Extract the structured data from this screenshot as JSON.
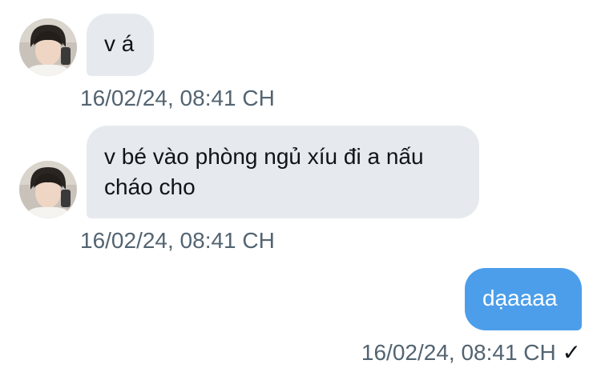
{
  "messages": [
    {
      "direction": "incoming",
      "text": "v á",
      "timestamp": "16/02/24, 08:41 CH"
    },
    {
      "direction": "incoming",
      "text": "v bé vào phòng ngủ xíu đi a nấu cháo cho",
      "timestamp": "16/02/24, 08:41 CH"
    },
    {
      "direction": "outgoing",
      "text": "dạaaaa",
      "timestamp": "16/02/24, 08:41 CH",
      "status_icon": "checkmark-icon",
      "status_glyph": "✓"
    }
  ],
  "colors": {
    "incoming_bubble": "#e6eaee",
    "outgoing_bubble": "#4c9eea",
    "timestamp_text": "#536471"
  }
}
